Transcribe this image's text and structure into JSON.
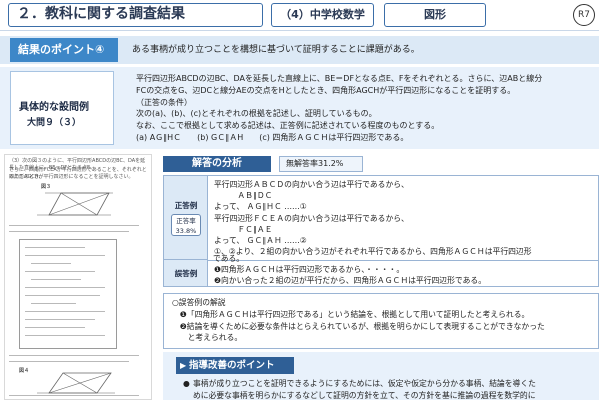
{
  "header": {
    "title": "２．教科に関する調査結果",
    "subject": "（4）中学校数学",
    "topic": "図形",
    "page": "R7"
  },
  "point": {
    "label": "結果のポイント④",
    "text": "ある事柄が成り立つことを構想に基づいて証明することに課題がある。"
  },
  "question": {
    "label": "具体的な設問例",
    "number": "大問９（３）",
    "lines": [
      "平行四辺形ABCDの辺BC、DAを延長した直線上に、BE＝DFとなる点E、Fをそれぞれとる。さらに、辺ABと線分",
      "FCの交点をG、辺DCと線分AEの交点をHとしたとき、四角形AGCHが平行四辺形になることを証明する。",
      "（正答の条件）",
      "次の(a)、(b)、(c)とそれぞれの根拠を記述し、証明しているもの。",
      "なお、ここで根拠として求める記述は、正答例に記述されている程度のものとする。",
      "(a)  AＧ∥HＣ　　(b)  GＣ∥ＡH　　(c)  四角形ＡＧＣＨは平行四辺形である。"
    ]
  },
  "analysis": {
    "heading": "解答の分析",
    "no_response_rate": "無解答率31.2%"
  },
  "correct_answer": {
    "label": "正答例",
    "rate_label": "正答率",
    "rate_value": "33.8%",
    "lines": [
      "平行四辺形ＡＢＣＤの向かい合う辺は平行であるから、",
      "　　　ＡＢ∥ＤＣ",
      "よって、 ＡＧ∥ＨＣ ……①",
      "平行四辺形ＦＣＥＡの向かい合う辺は平行であるから、",
      "　　　ＦＣ∥ＡＥ",
      "よって、 ＧＣ∥ＡＨ ……②",
      "①、②より、２組の向かい合う辺がそれぞれ平行であるから、四角形ＡＧＣＨは平行四辺形",
      "である。"
    ]
  },
  "wrong_answer": {
    "label": "誤答例",
    "lines": [
      "❶四角形ＡＧＣＨは平行四辺形であるから、・・・・。",
      "❷向かい合った２組の辺が平行だから、四角形ＡＧＣＨは平行四辺形である。"
    ]
  },
  "explanation": {
    "lines": [
      "○誤答例の解説",
      "　❶「四角形ＡＧＣＨは平行四辺形である」という結論を、根拠として用いて証明したと考えられる。",
      "　❷結論を導くために必要な条件はとらえられているが、根拠を明らかにして表現することができなかった",
      "　　と考えられる。"
    ]
  },
  "guidance": {
    "heading": "指導改善のポイント",
    "lines": [
      "事柄が成り立つことを証明できるようにするためには、仮定や仮定から分かる事柄、結論を導くた",
      "めに必要な事柄を明らかにするなどして証明の方針を立て、その方針を基に推論の過程を数学的に"
    ]
  },
  "thumbnail": {
    "figure3_caption": "図３",
    "figure4_caption": "図４",
    "lines": [
      "（3）次の図３のように、平行四辺形ABCDの辺BC、DAを延長した直線上に、BE＝DFとなる点E、",
      "さらに、四角形FCEAが平行四辺形であることを、それぞれとる。このとき、",
      "四角形AGCHが平行四辺形になることを証明しなさい。"
    ]
  }
}
